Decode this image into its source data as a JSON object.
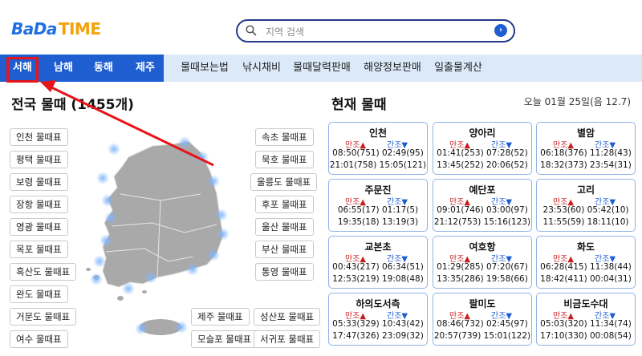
{
  "header": {
    "logo_bada": "BaDa",
    "logo_time": "TIME",
    "search_placeholder": "지역 검색"
  },
  "nav": {
    "main": [
      "서해",
      "남해",
      "동해",
      "제주"
    ],
    "sub": [
      "물때보는법",
      "낚시채비",
      "물때달력판매",
      "해양정보판매",
      "일출물계산"
    ]
  },
  "left": {
    "title": "전국 물때 (1455개)",
    "left_buttons": [
      "인천 물때표",
      "평택 물때표",
      "보령 물때표",
      "장항 물때표",
      "영광 물때표",
      "목포 물때표",
      "흑산도 물때표",
      "완도 물때표",
      "거문도 물때표",
      "여수 물때표"
    ],
    "right_buttons": [
      "속초 물때표",
      "묵호 물때표",
      "울릉도 물때표",
      "후포 물때표",
      "울산 물때표",
      "부산 물때표",
      "통영 물때표"
    ],
    "bottom_buttons": [
      "제주 물때표",
      "성산포 물때표",
      "모슬포 물때표",
      "서귀포 물때표"
    ]
  },
  "right": {
    "title": "현재 물때",
    "date": "오늘 01월 25일(음 12.7)",
    "high_label": "만조▲",
    "low_label": "간조▼",
    "cards": [
      {
        "name": "인천",
        "row1": "08:50(751) 02:49(95)",
        "row2": "21:01(758) 15:05(121)"
      },
      {
        "name": "양아리",
        "row1": "01:41(253) 07:28(52)",
        "row2": "13:45(252) 20:06(52)"
      },
      {
        "name": "별암",
        "row1": "06:18(376) 11:28(43)",
        "row2": "18:32(373) 23:54(31)"
      },
      {
        "name": "주문진",
        "row1": "06:55(17) 01:17(5)",
        "row2": "19:35(18) 13:19(3)"
      },
      {
        "name": "예단포",
        "row1": "09:01(746) 03:00(97)",
        "row2": "21:12(753) 15:16(123)"
      },
      {
        "name": "고리",
        "row1": "23:53(60) 05:42(10)",
        "row2": "11:55(59) 18:11(10)"
      },
      {
        "name": "교본초",
        "row1": "00:43(217) 06:34(51)",
        "row2": "12:53(219) 19:08(48)"
      },
      {
        "name": "여호항",
        "row1": "01:29(285) 07:20(67)",
        "row2": "13:35(286) 19:58(66)"
      },
      {
        "name": "화도",
        "row1": "06:28(415) 11:38(44)",
        "row2": "18:42(411) 00:04(31)"
      },
      {
        "name": "하의도서측",
        "row1": "05:33(329) 10:43(42)",
        "row2": "17:47(326) 23:09(32)"
      },
      {
        "name": "팔미도",
        "row1": "08:46(732) 02:45(97)",
        "row2": "20:57(739) 15:01(122)"
      },
      {
        "name": "비금도수대",
        "row1": "05:03(320) 11:34(74)",
        "row2": "17:10(330) 00:08(54)"
      }
    ]
  },
  "colors": {
    "brand_blue": "#1f5ed1",
    "brand_orange": "#f5a10b",
    "nav_bg": "#dbe9f8",
    "highlight_red": "#e8141b",
    "high_red": "#c81e1e",
    "card_border": "#8fb2e6"
  }
}
